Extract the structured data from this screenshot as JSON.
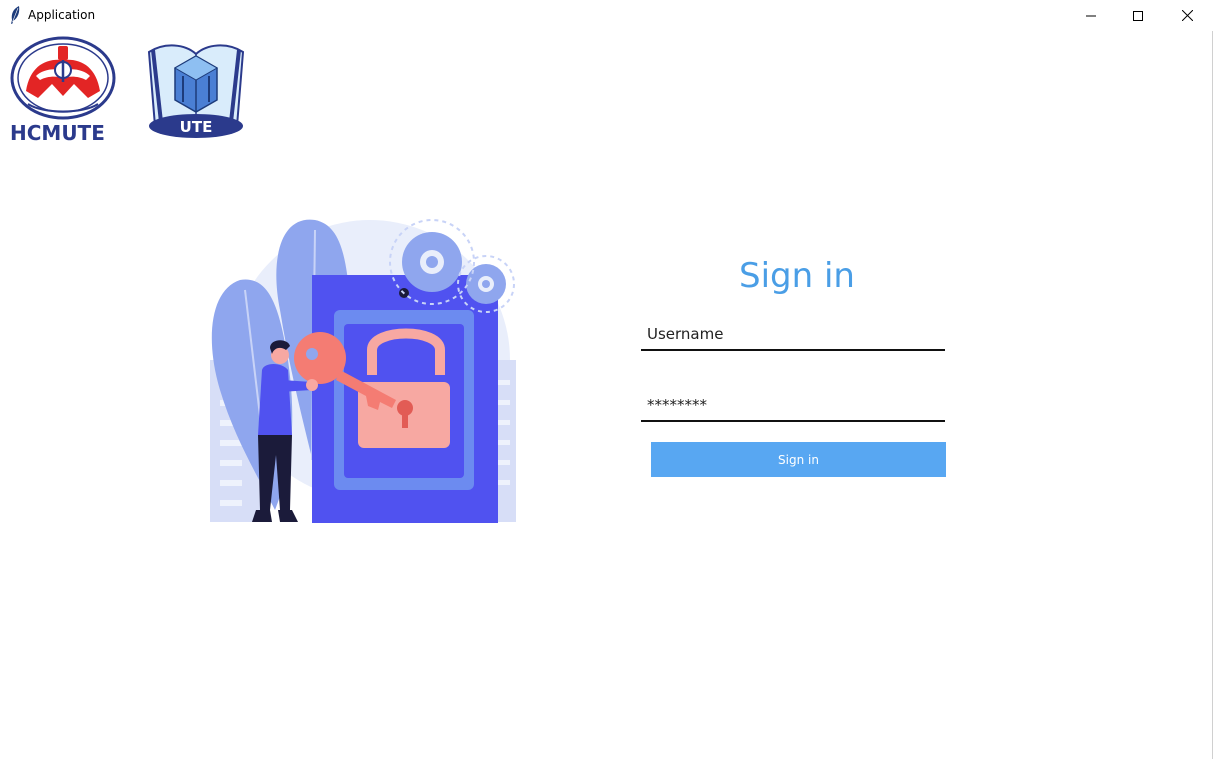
{
  "window": {
    "title": "Application",
    "controls": {
      "minimize": "minimize-icon",
      "maximize": "maximize-icon",
      "close": "close-icon"
    }
  },
  "logos": {
    "hcmute_text": "HCMUTE",
    "ute_text": "UTE"
  },
  "form": {
    "title": "Sign in",
    "username_value": "Username",
    "password_value": "********",
    "submit_label": "Sign in"
  },
  "colors": {
    "accent": "#4a9ee6",
    "button": "#58a7f2",
    "illustration_primary": "#5052f0",
    "illustration_secondary": "#8fa6ee",
    "key": "#f47c73"
  }
}
